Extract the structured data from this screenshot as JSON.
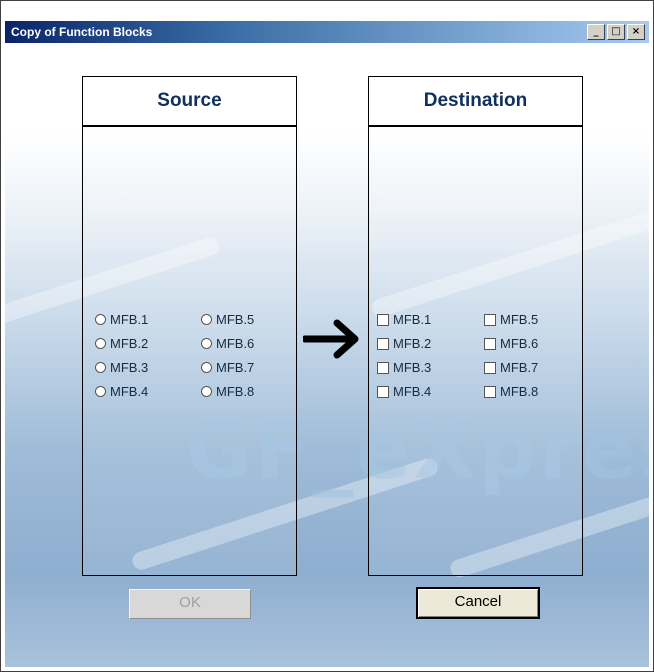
{
  "window": {
    "title": "Copy of Function Blocks",
    "minimize_glyph": "_",
    "maximize_glyph": "□",
    "close_glyph": "×"
  },
  "source": {
    "header": "Source",
    "options": [
      "MFB.1",
      "MFB.2",
      "MFB.3",
      "MFB.4",
      "MFB.5",
      "MFB.6",
      "MFB.7",
      "MFB.8"
    ]
  },
  "destination": {
    "header": "Destination",
    "options": [
      "MFB.1",
      "MFB.2",
      "MFB.3",
      "MFB.4",
      "MFB.5",
      "MFB.6",
      "MFB.7",
      "MFB.8"
    ]
  },
  "buttons": {
    "ok_label": "OK",
    "cancel_label": "Cancel"
  },
  "watermark": "GF_eXpres",
  "icons": {
    "arrow": "arrow-right-icon"
  }
}
